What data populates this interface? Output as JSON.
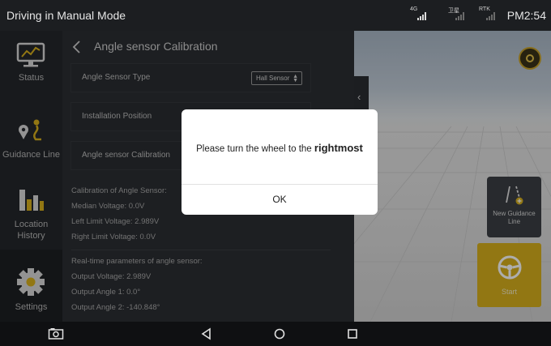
{
  "app": {
    "title": "Driving in Manual Mode",
    "time": "PM2:54"
  },
  "status_icons": [
    {
      "label": "4G",
      "name": "signal-4g-icon",
      "active": true
    },
    {
      "label": "卫星",
      "name": "satellite-signal-icon",
      "active": false
    },
    {
      "label": "RTK",
      "name": "rtk-signal-icon",
      "active": false
    }
  ],
  "sidebar": {
    "items": [
      {
        "label": "Status",
        "icon": "monitor-chart-icon"
      },
      {
        "label": "Guidance Line",
        "icon": "guidance-route-icon"
      },
      {
        "label": "Location History",
        "icon": "bar-chart-icon"
      },
      {
        "label": "Settings",
        "icon": "gear-icon",
        "active": true
      }
    ]
  },
  "panel": {
    "title": "Angle sensor Calibration",
    "rows": [
      {
        "label": "Angle Sensor Type",
        "value": "Hall Sensor"
      },
      {
        "label": "Installation Position",
        "value": ""
      },
      {
        "label": "Angle sensor Calibration"
      }
    ],
    "calibration": {
      "heading": "Calibration of Angle Sensor:",
      "median": "Median Voltage: 0.0V",
      "left": "Left Limit Voltage: 2.989V",
      "right": "Right Limit Voltage: 0.0V"
    },
    "realtime": {
      "heading": "Real-time parameters of angle sensor:",
      "output_voltage": "Output Voltage: 2.989V",
      "angle1": "Output Angle 1: 0.0°",
      "angle2": "Output Angle 2: -140.848°"
    }
  },
  "map": {
    "new_guidance_line": "New Guidance Line",
    "start": "Start"
  },
  "modal": {
    "message_prefix": "Please turn the wheel to the ",
    "message_emphasis": "rightmost",
    "ok": "OK"
  },
  "colors": {
    "accent": "#d8b01c",
    "panel": "#2b2e33",
    "sidebar": "#24272b"
  }
}
